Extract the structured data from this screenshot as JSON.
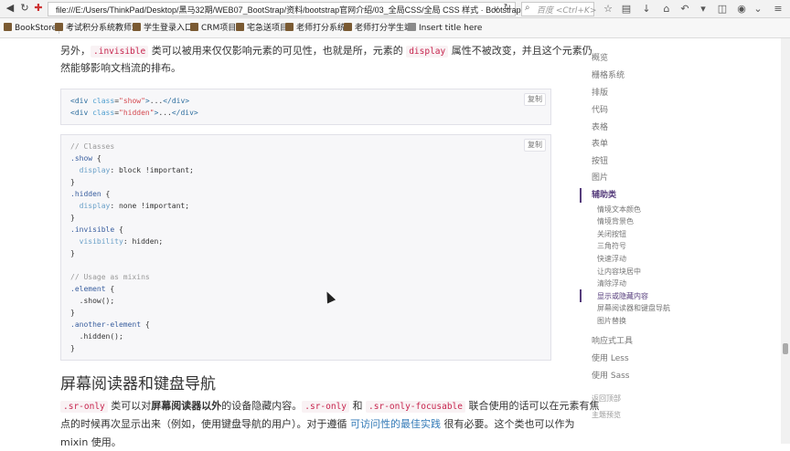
{
  "browser": {
    "url": "file:///E:/Users/ThinkPad/Desktop/黑马32期/WEB07_BootStrap/资料/bootstrap官网介绍/03_全局CSS/全局 CSS 样式 · Bootstrap",
    "url_suffix": "v",
    "search_placeholder": "百度 <Ctrl+K>"
  },
  "bookmarks": [
    {
      "label": "BookStore"
    },
    {
      "label": "考试积分系统教师端"
    },
    {
      "label": "学生登录入口"
    },
    {
      "label": "CRM项目"
    },
    {
      "label": "宅急送项目"
    },
    {
      "label": "老师打分系统"
    },
    {
      "label": "老师打分学生端"
    },
    {
      "label": "Insert title here"
    }
  ],
  "content": {
    "para1_a": "另外，",
    "para1_code1": ".invisible",
    "para1_b": " 类可以被用来仅仅影响元素的可见性，也就是所，元素的 ",
    "para1_code2": "display",
    "para1_c": " 属性不被改变，并且这个元素仍",
    "para1_line2": "然能够影响文档流的排布。",
    "copy_label": "复制",
    "copy_label2": "复制",
    "code1": [
      {
        "t": "<div",
        "c": "tag"
      },
      {
        "t": " class",
        "c": "attr"
      },
      {
        "t": "=",
        "c": ""
      },
      {
        "t": "\"show\"",
        "c": "str"
      },
      {
        "t": ">...</div>",
        "c": "tag"
      }
    ],
    "code1_line1": "<div class=\"show\">...</div>",
    "code1_line2": "<div class=\"hidden\">...</div>",
    "code2_lines": [
      "// Classes",
      ".show {",
      "  display: block !important;",
      "}",
      ".hidden {",
      "  display: none !important;",
      "}",
      ".invisible {",
      "  visibility: hidden;",
      "}",
      "",
      "// Usage as mixins",
      ".element {",
      "  .show();",
      "}",
      ".another-element {",
      "  .hidden();",
      "}"
    ],
    "heading": "屏幕阅读器和键盘导航",
    "para2_code1": ".sr-only",
    "para2_a": " 类可以对",
    "para2_bold": "屏幕阅读器以外",
    "para2_b": "的设备隐藏内容。",
    "para2_code2": ".sr-only",
    "para2_c": " 和 ",
    "para2_code3": ".sr-only-focusable",
    "para2_d": " 联合使用的话可以在元素有焦",
    "para3_a": "点的时候再次显示出来（例如，使用键盘导航的用户）。对于遵循 ",
    "para3_link": "可访问性的最佳实践",
    "para3_b": " 很有必要。这个类也可以作为",
    "para4": "mixin 使用。"
  },
  "sidebar": {
    "items": [
      {
        "label": "概览"
      },
      {
        "label": "栅格系统"
      },
      {
        "label": "排版"
      },
      {
        "label": "代码"
      },
      {
        "label": "表格"
      },
      {
        "label": "表单"
      },
      {
        "label": "按钮"
      },
      {
        "label": "图片"
      },
      {
        "label": "辅助类"
      }
    ],
    "subitems": [
      {
        "label": "情境文本颜色"
      },
      {
        "label": "情境背景色"
      },
      {
        "label": "关闭按钮"
      },
      {
        "label": "三角符号"
      },
      {
        "label": "快速浮动"
      },
      {
        "label": "让内容块居中"
      },
      {
        "label": "清除浮动"
      },
      {
        "label": "显示或隐藏内容"
      },
      {
        "label": "屏幕阅读器和键盘导航"
      },
      {
        "label": "图片替换"
      }
    ],
    "after": [
      {
        "label": "响应式工具"
      },
      {
        "label": "使用 Less"
      },
      {
        "label": "使用 Sass"
      }
    ],
    "back_to_top": "返回顶部",
    "theme_preview": "主题预览"
  }
}
